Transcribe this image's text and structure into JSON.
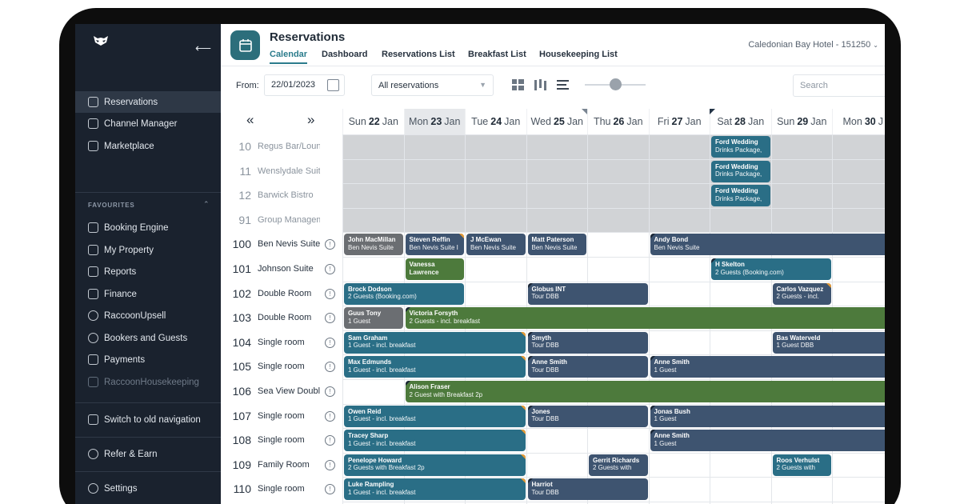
{
  "colors": {
    "sidebar_bg": "#1a222e",
    "accent": "#2b7c8c",
    "booking_blue": "#2a6e86",
    "booking_navy": "#3e5470",
    "booking_green": "#4d7a3c",
    "booking_grey": "#6b6e72"
  },
  "sidebar": {
    "collapse_icon": "arrow-left-icon",
    "main_items": [
      {
        "label": "Reservations",
        "icon": "calendar-icon"
      },
      {
        "label": "Channel Manager",
        "icon": "channel-icon"
      },
      {
        "label": "Marketplace",
        "icon": "grid-plus-icon"
      }
    ],
    "favourites_heading": "FAVOURITES",
    "favourites": [
      {
        "label": "Booking Engine",
        "icon": "monitor-icon"
      },
      {
        "label": "My Property",
        "icon": "property-icon"
      },
      {
        "label": "Reports",
        "icon": "report-icon"
      },
      {
        "label": "Finance",
        "icon": "finance-icon"
      },
      {
        "label": "RaccoonUpsell",
        "icon": "plus-circle-icon"
      },
      {
        "label": "Bookers and Guests",
        "icon": "users-icon"
      },
      {
        "label": "Payments",
        "icon": "card-icon"
      },
      {
        "label": "RaccoonHousekeeping",
        "icon": "broom-icon"
      }
    ],
    "switch_label": "Switch to old navigation",
    "refer_label": "Refer & Earn",
    "settings_label": "Settings"
  },
  "header": {
    "title": "Reservations",
    "tabs": [
      "Calendar",
      "Dashboard",
      "Reservations List",
      "Breakfast List",
      "Housekeeping List"
    ],
    "hotel": "Caledonian Bay Hotel - 151250"
  },
  "toolbar": {
    "from_label": "From:",
    "date": "22/01/2023",
    "filter": "All reservations",
    "search_placeholder": "Search"
  },
  "calendar": {
    "prev": "«",
    "next": "»",
    "days": [
      {
        "dow": "Sun",
        "num": "22",
        "mon": "Jan"
      },
      {
        "dow": "Mon",
        "num": "23",
        "mon": "Jan"
      },
      {
        "dow": "Tue",
        "num": "24",
        "mon": "Jan"
      },
      {
        "dow": "Wed",
        "num": "25",
        "mon": "Jan"
      },
      {
        "dow": "Thu",
        "num": "26",
        "mon": "Jan"
      },
      {
        "dow": "Fri",
        "num": "27",
        "mon": "Jan"
      },
      {
        "dow": "Sat",
        "num": "28",
        "mon": "Jan"
      },
      {
        "dow": "Sun",
        "num": "29",
        "mon": "Jan"
      },
      {
        "dow": "Mon",
        "num": "30",
        "mon": "J"
      }
    ],
    "rooms": [
      {
        "num": "10",
        "name": "Regus Bar/Lounge"
      },
      {
        "num": "11",
        "name": "Wenslydale Suite"
      },
      {
        "num": "12",
        "name": "Barwick Bistro"
      },
      {
        "num": "91",
        "name": "Group Manageme..."
      },
      {
        "num": "100",
        "name": "Ben Nevis Suite"
      },
      {
        "num": "101",
        "name": "Johnson Suite"
      },
      {
        "num": "102",
        "name": "Double Room"
      },
      {
        "num": "103",
        "name": "Double Room"
      },
      {
        "num": "104",
        "name": "Single room"
      },
      {
        "num": "105",
        "name": "Single room"
      },
      {
        "num": "106",
        "name": "Sea View Double"
      },
      {
        "num": "107",
        "name": "Single room"
      },
      {
        "num": "108",
        "name": "Single room"
      },
      {
        "num": "109",
        "name": "Family Room"
      },
      {
        "num": "110",
        "name": "Single room"
      }
    ],
    "bookings": [
      {
        "row": 0,
        "start": 6,
        "span": 1,
        "name": "Ford Wedding",
        "detail": "Drinks Package,",
        "color": "booking_blue"
      },
      {
        "row": 1,
        "start": 6,
        "span": 1,
        "name": "Ford Wedding",
        "detail": "Drinks Package,",
        "color": "booking_blue"
      },
      {
        "row": 2,
        "start": 6,
        "span": 1,
        "name": "Ford Wedding",
        "detail": "Drinks Package,",
        "color": "booking_blue"
      },
      {
        "row": 4,
        "start": 0,
        "span": 1,
        "name": "John MacMillan",
        "detail": "Ben Nevis Suite",
        "color": "booking_grey"
      },
      {
        "row": 4,
        "start": 1,
        "span": 1,
        "name": "Steven Reffin",
        "detail": "Ben Nevis Suite I",
        "color": "booking_navy",
        "corner": "r"
      },
      {
        "row": 4,
        "start": 2,
        "span": 1,
        "name": "J McEwan",
        "detail": "Ben Nevis Suite",
        "color": "booking_navy"
      },
      {
        "row": 4,
        "start": 3,
        "span": 1,
        "name": "Matt Paterson",
        "detail": "Ben Nevis Suite",
        "color": "booking_navy"
      },
      {
        "row": 4,
        "start": 5,
        "span": 4,
        "name": "Andy Bond",
        "detail": "Ben Nevis Suite",
        "color": "booking_navy",
        "corner": "l"
      },
      {
        "row": 5,
        "start": 1,
        "span": 1,
        "name": "Vanessa",
        "detail": "Lawrence",
        "color": "booking_green",
        "bold2": true
      },
      {
        "row": 5,
        "start": 6,
        "span": 2,
        "name": "H Skelton",
        "detail": "2 Guests (Booking.com)",
        "color": "booking_blue",
        "corner": "l"
      },
      {
        "row": 6,
        "start": 0,
        "span": 2,
        "name": "Brock Dodson",
        "detail": "2 Guests (Booking.com)",
        "color": "booking_blue"
      },
      {
        "row": 6,
        "start": 3,
        "span": 2,
        "name": "Globus INT",
        "detail": "Tour DBB",
        "color": "booking_navy",
        "corner": "l"
      },
      {
        "row": 6,
        "start": 7,
        "span": 1,
        "name": "Carlos Vazquez",
        "detail": "2 Guests - incl.",
        "color": "booking_navy",
        "corner": "r"
      },
      {
        "row": 7,
        "start": 0,
        "span": 1,
        "name": "Guus Tony",
        "detail": "1 Guest",
        "color": "booking_grey"
      },
      {
        "row": 7,
        "start": 1,
        "span": 8,
        "name": "Victoria Forsyth",
        "detail": "2 Guests - incl. breakfast",
        "color": "booking_green",
        "corner": "l"
      },
      {
        "row": 8,
        "start": 0,
        "span": 3,
        "name": "Sam Graham",
        "detail": "1 Guest - incl. breakfast",
        "color": "booking_blue",
        "corner": "r"
      },
      {
        "row": 8,
        "start": 3,
        "span": 2,
        "name": "Smyth",
        "detail": "Tour DBB",
        "color": "booking_navy",
        "corner": "l"
      },
      {
        "row": 8,
        "start": 7,
        "span": 2,
        "name": "Bas Waterveld",
        "detail": "1 Guest DBB",
        "color": "booking_navy"
      },
      {
        "row": 9,
        "start": 0,
        "span": 3,
        "name": "Max Edmunds",
        "detail": "1 Guest - incl. breakfast",
        "color": "booking_blue",
        "corner": "r"
      },
      {
        "row": 9,
        "start": 3,
        "span": 2,
        "name": "Anne Smith",
        "detail": "Tour DBB",
        "color": "booking_navy",
        "corner": "l"
      },
      {
        "row": 9,
        "start": 5,
        "span": 4,
        "name": "Anne Smith",
        "detail": "1 Guest",
        "color": "booking_navy",
        "corner": "l"
      },
      {
        "row": 10,
        "start": 1,
        "span": 8,
        "name": "Alison Fraser",
        "detail": "2 Guest with Breakfast 2p",
        "color": "booking_green",
        "corner": "l"
      },
      {
        "row": 11,
        "start": 0,
        "span": 3,
        "name": "Owen Reid",
        "detail": "1 Guest - incl. breakfast",
        "color": "booking_blue",
        "corner": "r"
      },
      {
        "row": 11,
        "start": 3,
        "span": 2,
        "name": "Jones",
        "detail": "Tour DBB",
        "color": "booking_navy",
        "corner": "l"
      },
      {
        "row": 11,
        "start": 5,
        "span": 4,
        "name": "Jonas Bush",
        "detail": "1 Guest",
        "color": "booking_navy",
        "corner": "l"
      },
      {
        "row": 12,
        "start": 0,
        "span": 3,
        "name": "Tracey Sharp",
        "detail": "1 Guest - incl. breakfast",
        "color": "booking_blue",
        "corner": "r"
      },
      {
        "row": 12,
        "start": 5,
        "span": 4,
        "name": "Anne Smith",
        "detail": "1 Guest",
        "color": "booking_navy",
        "corner": "l"
      },
      {
        "row": 13,
        "start": 0,
        "span": 3,
        "name": "Penelope Howard",
        "detail": "2 Guests with Breakfast 2p",
        "color": "booking_blue",
        "corner": "r"
      },
      {
        "row": 13,
        "start": 4,
        "span": 1,
        "name": "Gerrit Richards",
        "detail": "2 Guests with",
        "color": "booking_navy"
      },
      {
        "row": 13,
        "start": 7,
        "span": 1,
        "name": "Roos Verhulst",
        "detail": "2 Guests with",
        "color": "booking_blue"
      },
      {
        "row": 14,
        "start": 0,
        "span": 3,
        "name": "Luke Rampling",
        "detail": "1 Guest - incl. breakfast",
        "color": "booking_blue",
        "corner": "r"
      },
      {
        "row": 14,
        "start": 3,
        "span": 2,
        "name": "Harriot",
        "detail": "Tour DBB",
        "color": "booking_navy",
        "corner": "l"
      }
    ]
  }
}
